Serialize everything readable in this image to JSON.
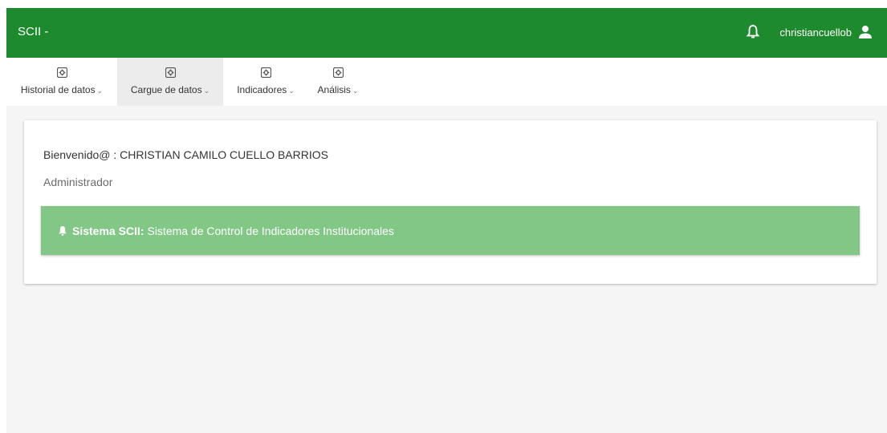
{
  "header": {
    "brand": "SCII -",
    "username": "christiancuellob",
    "bg_color": "#1e8a2e"
  },
  "menu": {
    "items": [
      {
        "label": "Historial de datos",
        "icon": "gear-box-icon"
      },
      {
        "label": "Cargue de datos",
        "icon": "gear-box-icon",
        "active": true
      },
      {
        "label": "Indicadores",
        "icon": "gear-box-icon"
      },
      {
        "label": "Análisis",
        "icon": "gear-box-icon"
      }
    ],
    "caret": "⌄"
  },
  "card": {
    "welcome": "Bienvenido@ : CHRISTIAN CAMILO CUELLO BARRIOS",
    "role": "Administrador",
    "alert": {
      "title": "Sistema SCII:",
      "text": "Sistema de Control de Indicadores Institucionales",
      "bg_color": "#82c785"
    }
  }
}
